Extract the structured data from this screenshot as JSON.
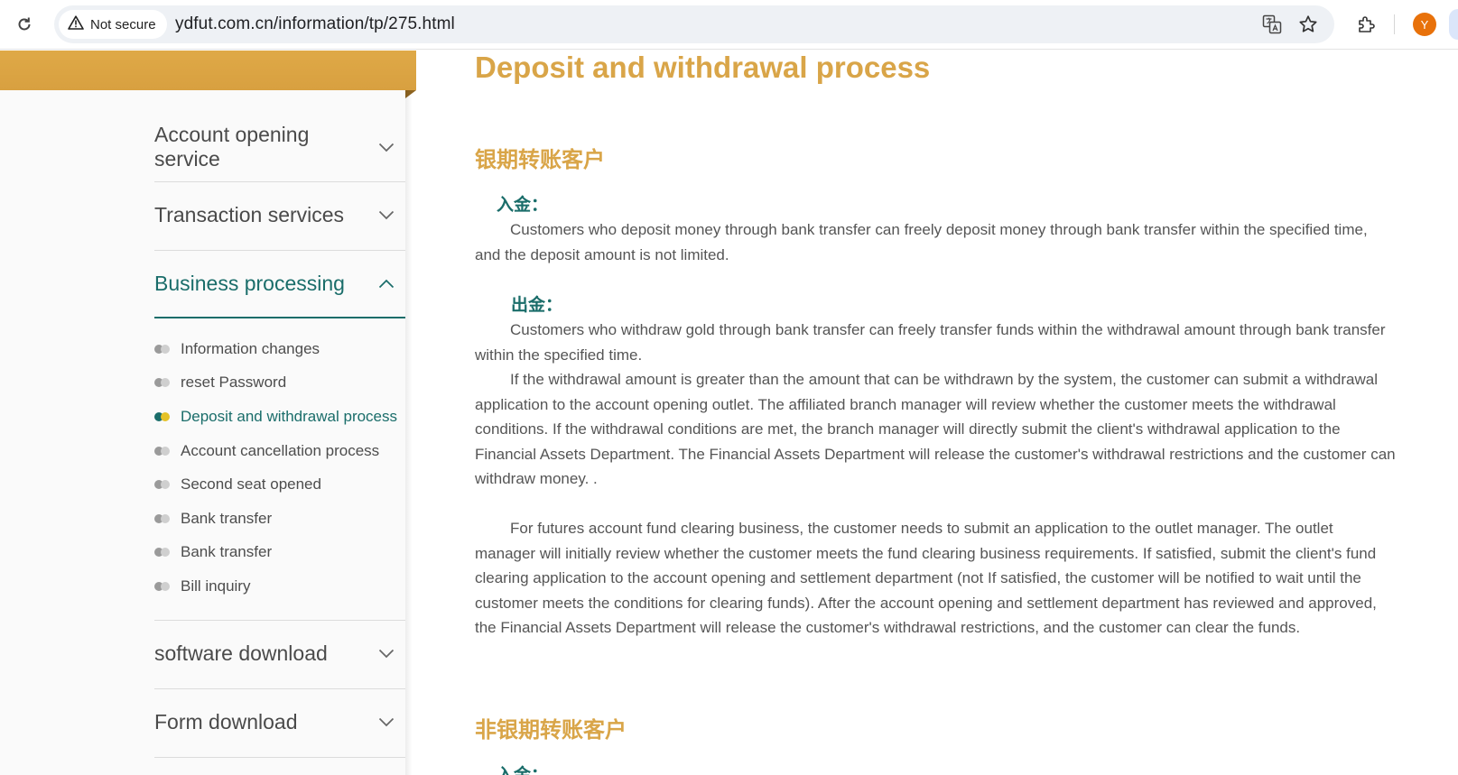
{
  "browser": {
    "security_label": "Not secure",
    "url": "ydfut.com.cn/information/tp/275.html",
    "avatar_initial": "Y",
    "icons": [
      "reload-icon",
      "warning-icon",
      "translate-icon",
      "bookmark-star-icon",
      "extensions-icon"
    ],
    "avatar_color": "#e8710a"
  },
  "sidebar": {
    "sections": [
      {
        "label": "Account opening service",
        "expanded": false
      },
      {
        "label": "Transaction services",
        "expanded": false
      },
      {
        "label": "Business processing",
        "expanded": true
      },
      {
        "label": "software download",
        "expanded": false
      },
      {
        "label": "Form download",
        "expanded": false
      }
    ],
    "sub_items": [
      {
        "label": "Information changes",
        "current": false
      },
      {
        "label": "reset Password",
        "current": false
      },
      {
        "label": "Deposit and withdrawal process",
        "current": true
      },
      {
        "label": "Account cancellation process",
        "current": false
      },
      {
        "label": "Second seat opened",
        "current": false
      },
      {
        "label": "Bank transfer",
        "current": false
      },
      {
        "label": "Bank transfer",
        "current": false
      },
      {
        "label": "Bill inquiry",
        "current": false
      }
    ],
    "banner_color": "#dba544",
    "active_color": "#1a6d6a"
  },
  "content": {
    "title": "Deposit and withdrawal process",
    "section1": {
      "heading": "银期转账客户",
      "deposit_label": "入金：",
      "deposit_text": "Customers who deposit money through bank transfer can freely deposit money through bank transfer within the specified time, and the deposit amount is not limited.",
      "withdraw_label": "出金：",
      "withdraw_text": "Customers who withdraw gold through bank transfer can freely transfer funds within the withdrawal amount through bank transfer within the specified time.",
      "withdraw_text2": "If the withdrawal amount is greater than the amount that can be withdrawn by the system, the customer can submit a withdrawal application to the account opening outlet. The affiliated branch manager will review whether the customer meets the withdrawal conditions. If the withdrawal conditions are met, the branch manager will directly submit the client's withdrawal application to the Financial Assets Department. The Financial Assets Department will release the customer's withdrawal restrictions and the customer can withdraw money. .",
      "clearing_text": "For futures account fund clearing business, the customer needs to submit an application to the outlet manager. The outlet manager will initially review whether the customer meets the fund clearing business requirements. If satisfied, submit the client's fund clearing application to the account opening and settlement department (not If satisfied, the customer will be notified to wait until the customer meets the conditions for clearing funds). After the account opening and settlement department has reviewed and approved, the Financial Assets Department will release the customer's withdrawal restrictions, and the customer can clear the funds."
    },
    "section2": {
      "heading": "非银期转账客户",
      "deposit_label": "入金："
    },
    "heading_color": "#d9a548",
    "label_color": "#1a6d6a"
  }
}
